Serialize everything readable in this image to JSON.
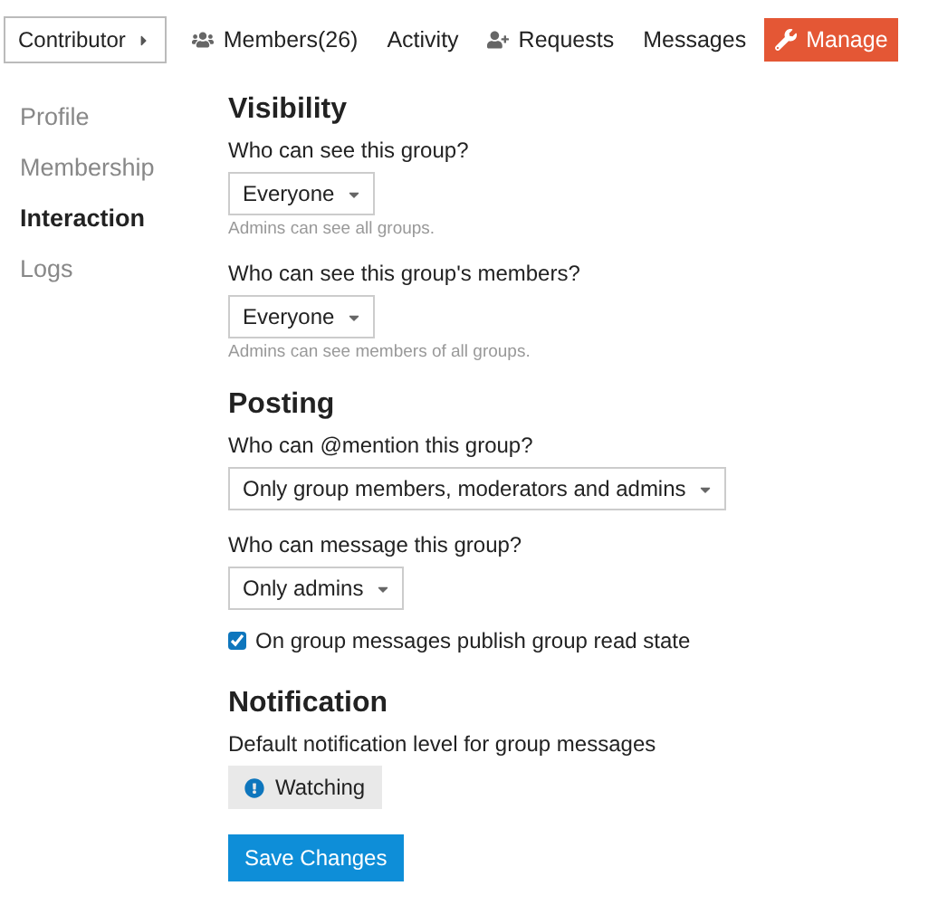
{
  "nav": {
    "dropdown": "Contributor",
    "tabs": [
      {
        "label": "Members(26)",
        "kind": "members",
        "selected": false
      },
      {
        "label": "Activity",
        "kind": "plain",
        "selected": false
      },
      {
        "label": "Requests",
        "kind": "requests",
        "selected": false
      },
      {
        "label": "Messages",
        "kind": "plain",
        "selected": false
      },
      {
        "label": "Manage",
        "kind": "manage",
        "selected": true
      }
    ]
  },
  "sidebar": {
    "items": [
      {
        "label": "Profile",
        "selected": false
      },
      {
        "label": "Membership",
        "selected": false
      },
      {
        "label": "Interaction",
        "selected": true
      },
      {
        "label": "Logs",
        "selected": false
      }
    ]
  },
  "sections": [
    {
      "title": "Visibility",
      "fields": [
        {
          "kind": "select",
          "label": "Who can see this group?",
          "value": "Everyone",
          "hint": "Admins can see all groups."
        },
        {
          "kind": "select",
          "label": "Who can see this group's members?",
          "value": "Everyone",
          "hint": "Admins can see members of all groups."
        }
      ]
    },
    {
      "title": "Posting",
      "fields": [
        {
          "kind": "select",
          "label": "Who can @mention this group?",
          "value": "Only group members, moderators and admins"
        },
        {
          "kind": "select",
          "label": "Who can message this group?",
          "value": "Only admins"
        },
        {
          "kind": "checkbox",
          "label": "On group messages publish group read state",
          "checked": true
        }
      ]
    },
    {
      "title": "Notification",
      "fields": [
        {
          "kind": "notification",
          "label": "Default notification level for group messages",
          "value": "Watching"
        }
      ]
    }
  ],
  "save_button": "Save Changes"
}
